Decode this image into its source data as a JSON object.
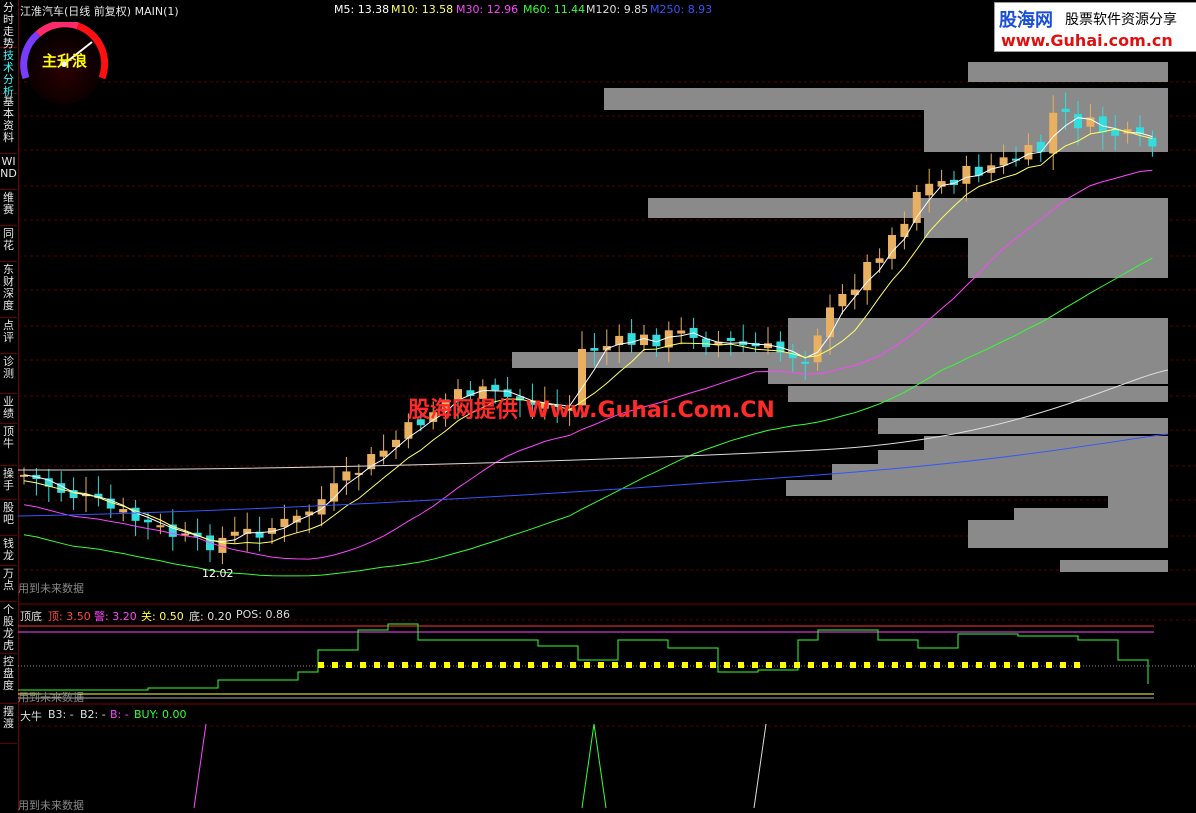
{
  "sidebar": {
    "tabs": [
      {
        "label": "分时走势",
        "active": false
      },
      {
        "label": "技术分析",
        "active": true
      },
      {
        "label": "基本资料",
        "active": false
      },
      {
        "label": "WIND",
        "active": false
      },
      {
        "label": "维赛",
        "active": false
      },
      {
        "label": "同花",
        "active": false
      },
      {
        "label": "东财深度",
        "active": false
      },
      {
        "label": "点评",
        "active": false
      },
      {
        "label": "诊测",
        "active": false
      },
      {
        "label": "业绩",
        "active": false
      },
      {
        "label": "顶牛",
        "active": false
      },
      {
        "label": "操手",
        "active": false
      },
      {
        "label": "股吧",
        "active": false
      },
      {
        "label": "钱龙",
        "active": false
      },
      {
        "label": "万点",
        "active": false
      },
      {
        "label": "个股龙虎",
        "active": false
      },
      {
        "label": "控盘度",
        "active": false
      },
      {
        "label": "摆渡",
        "active": false
      }
    ]
  },
  "header": {
    "title": "江淮汽车(日线 前复权) MAIN(1)",
    "ma": [
      {
        "label": "M5: 13.38",
        "color": "#ffffff"
      },
      {
        "label": "M10: 13.58",
        "color": "#ffff66"
      },
      {
        "label": "M30: 12.96",
        "color": "#ff44ff"
      },
      {
        "label": "M60: 11.44",
        "color": "#33ff33"
      },
      {
        "label": "M120: 9.85",
        "color": "#dddddd"
      },
      {
        "label": "M250: 8.93",
        "color": "#3355ff"
      }
    ]
  },
  "gauge": {
    "label": "主升浪"
  },
  "logo": {
    "title": "股海网",
    "subtitle": "股票软件资源分享",
    "url": "www.Guhai.com.cn"
  },
  "watermark": "股海网提供 Www.Guhai.Com.CN",
  "main_chart": {
    "low_label": "12.02",
    "future_note": "用到未来数据"
  },
  "panel1": {
    "name": "顶底",
    "items": [
      {
        "label": "顶: 3.50",
        "color": "#ff4444"
      },
      {
        "label": "警: 3.20",
        "color": "#ff44ff"
      },
      {
        "label": "关: 0.50",
        "color": "#ffff44"
      },
      {
        "label": "底: 0.20",
        "color": "#dddddd"
      },
      {
        "label": "POS: 0.86",
        "color": "#dddddd"
      }
    ],
    "note": "用到未来数据"
  },
  "panel2": {
    "name": "大牛",
    "items": [
      {
        "label": "B3: -",
        "color": "#dddddd"
      },
      {
        "label": "B2: -",
        "color": "#dddddd"
      },
      {
        "label": "B: -",
        "color": "#ff44ff"
      },
      {
        "label": "BUY: 0.00",
        "color": "#33ff33"
      }
    ],
    "note": "用到未来数据"
  },
  "colors": {
    "up": "#e8b060",
    "down": "#33dddd",
    "bg": "#000000",
    "grid": "#660000"
  }
}
